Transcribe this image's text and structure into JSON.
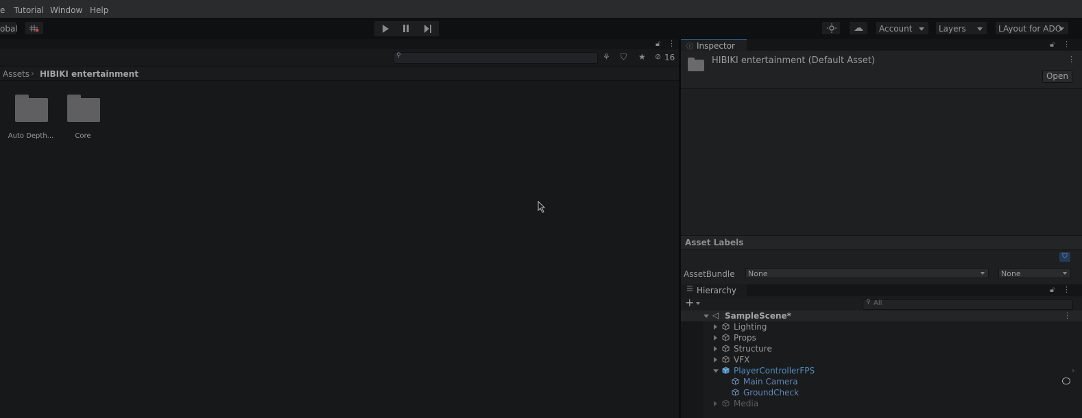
{
  "menubar": {
    "items": [
      "e",
      "Tutorial",
      "Window",
      "Help"
    ]
  },
  "toolbar": {
    "left_label": "obal",
    "account_label": "Account",
    "layers_label": "Layers",
    "layout_label": "LAyout for ADO"
  },
  "project": {
    "hidden_count": "16",
    "breadcrumb": {
      "root": "Assets",
      "current": "HIBIKI entertainment"
    },
    "folders": [
      {
        "label": "Auto Depth..."
      },
      {
        "label": "Core"
      }
    ]
  },
  "inspector": {
    "tab_label": "Inspector",
    "asset_title": "HIBIKI entertainment (Default Asset)",
    "open_label": "Open",
    "asset_labels_title": "Asset Labels",
    "assetbundle_label": "AssetBundle",
    "assetbundle_value": "None",
    "variant_value": "None"
  },
  "hierarchy": {
    "tab_label": "Hierarchy",
    "search_placeholder": "All",
    "scene": "SampleScene*",
    "items": [
      {
        "label": "Lighting"
      },
      {
        "label": "Props"
      },
      {
        "label": "Structure"
      },
      {
        "label": "VFX"
      },
      {
        "label": "PlayerControllerFPS"
      },
      {
        "label": "Main Camera"
      },
      {
        "label": "GroundCheck"
      },
      {
        "label": "Media"
      }
    ]
  },
  "colors": {
    "accent": "#2b5b8a",
    "prefab_blue": "#4f8fc0",
    "prefab_child": "#5f88b8"
  }
}
